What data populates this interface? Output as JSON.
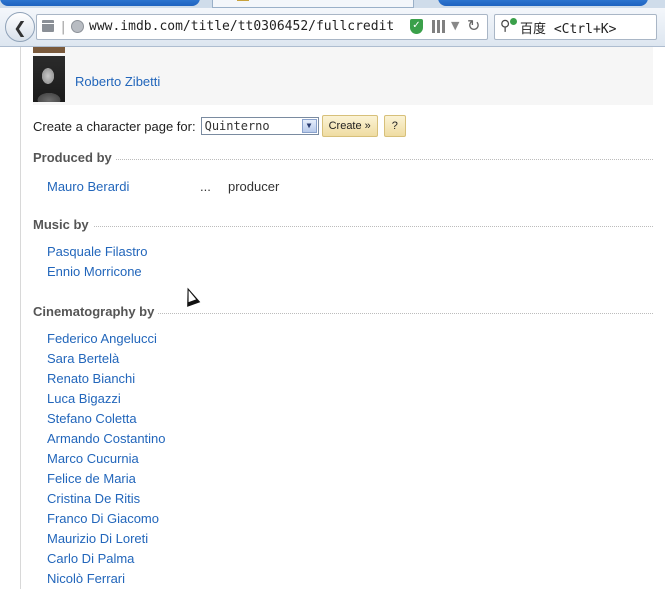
{
  "browser": {
    "address": "www.imdb.com/title/tt0306452/fullcredit",
    "search_placeholder": "百度 <Ctrl+K>"
  },
  "cast": {
    "last_member": "Roberto Zibetti"
  },
  "character_page": {
    "label": "Create a character page for:",
    "selected": "Quinterno",
    "create_label": "Create »",
    "help_label": "?"
  },
  "sections": {
    "produced": {
      "title": "Produced by",
      "credits": [
        {
          "name": "Mauro Berardi",
          "sep": "...",
          "role": "producer"
        }
      ]
    },
    "music": {
      "title": "Music by",
      "credits": [
        "Pasquale Filastro",
        "Ennio Morricone"
      ]
    },
    "cinematography": {
      "title": "Cinematography by",
      "credits": [
        "Federico Angelucci",
        "Sara Bertelà",
        "Renato Bianchi",
        "Luca Bigazzi",
        "Stefano Coletta",
        "Armando Costantino",
        "Marco Cucurnia",
        "Felice de Maria",
        "Cristina De Ritis",
        "Franco Di Giacomo",
        "Maurizio Di Loreti",
        "Carlo Di Palma",
        "Nicolò Ferrari"
      ]
    }
  },
  "colors": {
    "link": "#2266bb",
    "button": "#efdca2"
  }
}
